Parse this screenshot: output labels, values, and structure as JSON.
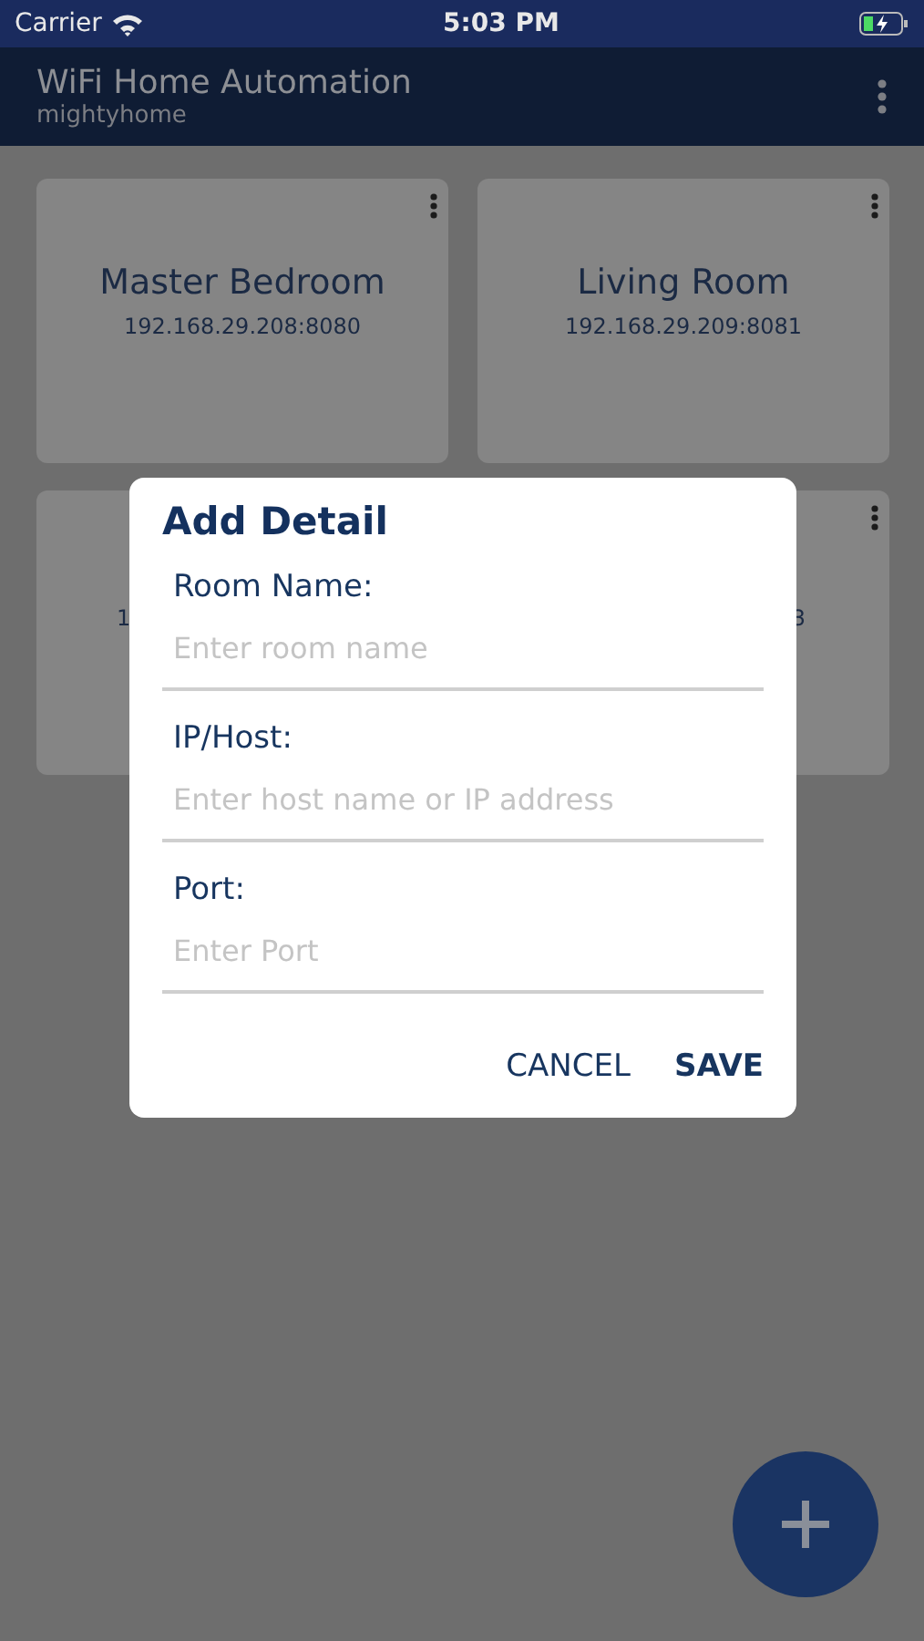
{
  "status_bar": {
    "carrier": "Carrier",
    "time": "5:03 PM"
  },
  "app_bar": {
    "title": "WiFi Home Automation",
    "subtitle": "mightyhome"
  },
  "rooms": [
    {
      "name": "Master Bedroom",
      "address": "192.168.29.208:8080",
      "menu": true
    },
    {
      "name": "Living Room",
      "address": "192.168.29.209:8081",
      "menu": true
    },
    {
      "address": "1",
      "kind": "leftcut",
      "menu": false
    },
    {
      "address": "3",
      "kind": "rightcut",
      "menu": true
    }
  ],
  "dialog": {
    "title": "Add Detail",
    "fields": [
      {
        "label": "Room Name:",
        "placeholder": "Enter room name"
      },
      {
        "label": "IP/Host:",
        "placeholder": "Enter host name or IP address"
      },
      {
        "label": "Port:",
        "placeholder": "Enter Port"
      }
    ],
    "buttons": [
      {
        "label": "CANCEL",
        "primary": false
      },
      {
        "label": "SAVE",
        "primary": true
      }
    ]
  }
}
